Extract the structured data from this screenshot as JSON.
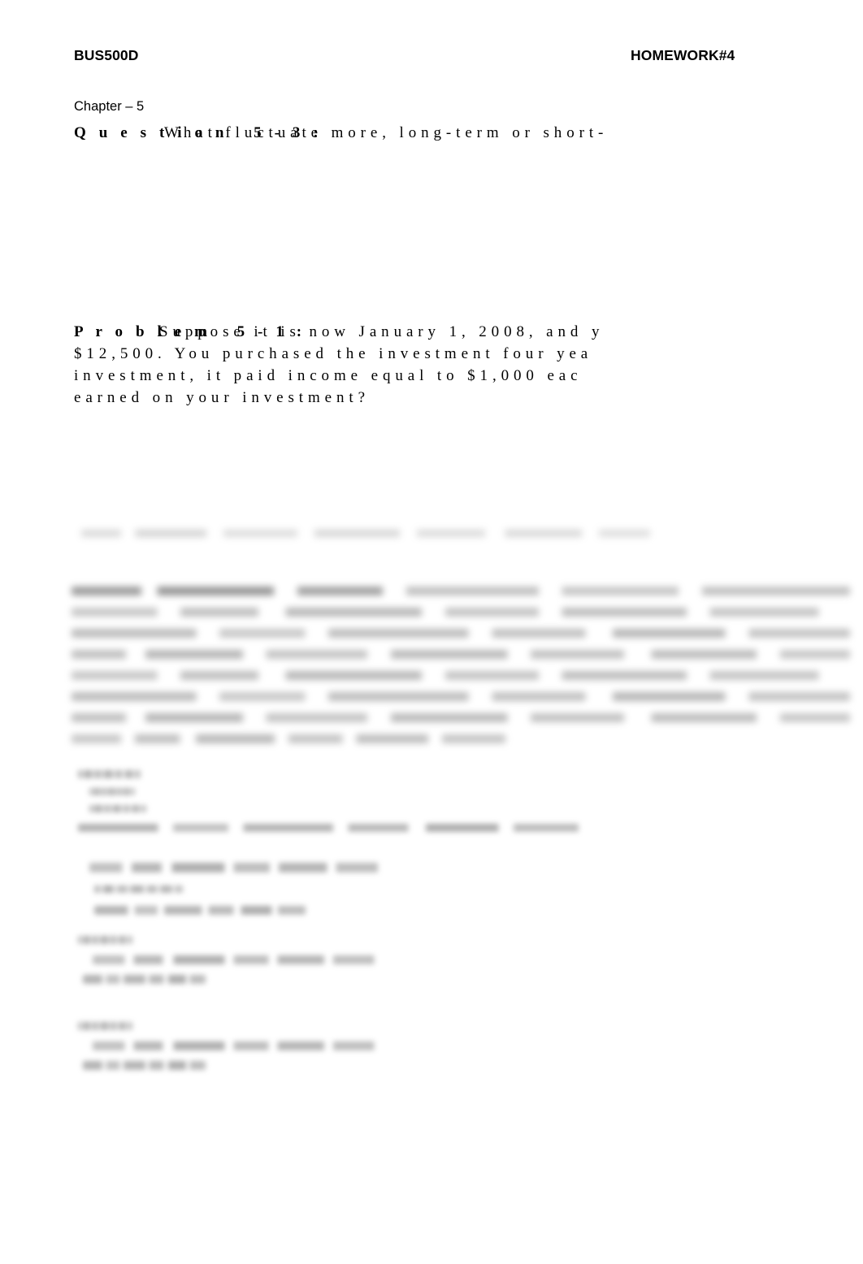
{
  "document": {
    "header": {
      "course_code": "BUS500D",
      "assignment_title": "HOMEWORK#4"
    },
    "chapter": "Chapter – 5",
    "question": {
      "label": "Q u e s t i o n   5 - 3 :",
      "text": "What fluctuate more, long-term or short-"
    },
    "problem": {
      "label": "P r o b l e m   5 - 1 :",
      "text_first_segment": "Suppose it is now January 1, 2008, and y",
      "text_lines": [
        "$12,500. You purchased the investment four yea",
        "investment, it paid income equal to $1,000 eac",
        "earned on your investment?"
      ]
    },
    "redacted": {
      "note": "blurred-content",
      "table_header_row": "",
      "paragraph_block": "",
      "answer_block_a": "",
      "answer_block_b": "",
      "answer_block_c": ""
    }
  }
}
